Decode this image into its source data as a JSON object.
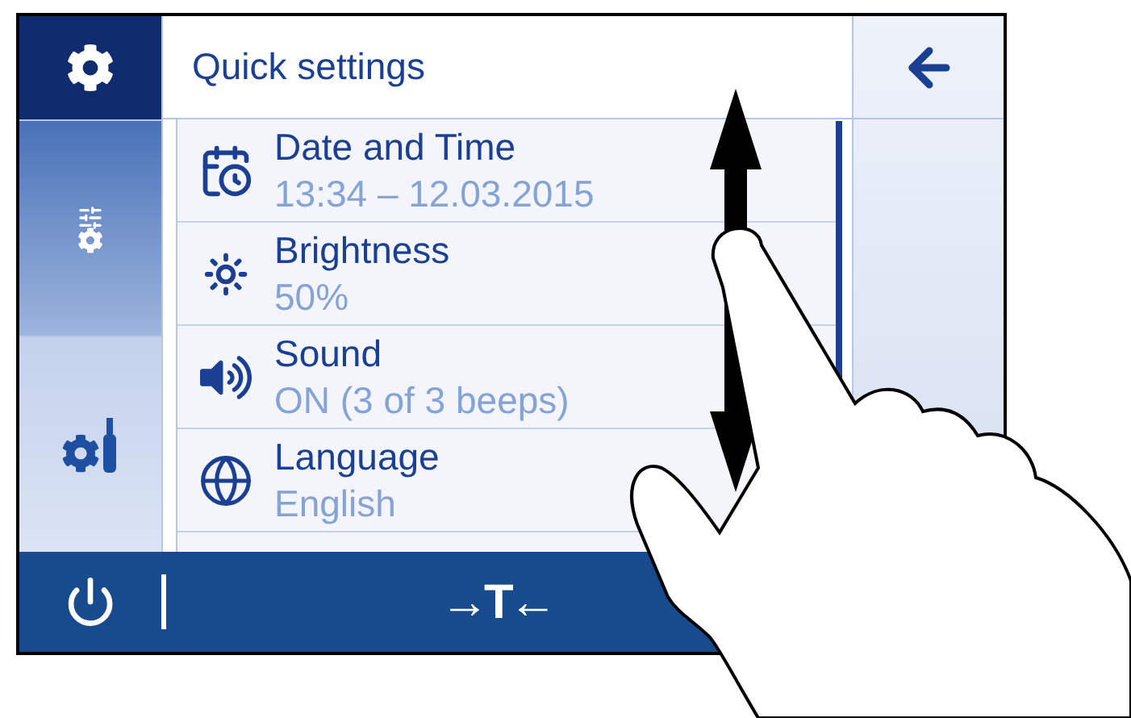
{
  "sidebar": {
    "items": [
      {
        "kind": "settings",
        "selected": true
      },
      {
        "kind": "configuration",
        "selected": false
      },
      {
        "kind": "maintenance",
        "selected": false
      }
    ]
  },
  "header": {
    "title": "Quick settings"
  },
  "settings_list": [
    {
      "kind": "datetime",
      "label": "Date and Time",
      "value": "13:34 – 12.03.2015"
    },
    {
      "kind": "brightness",
      "label": "Brightness",
      "value": "50%"
    },
    {
      "kind": "sound",
      "label": "Sound",
      "value": "ON (3 of 3 beeps)"
    },
    {
      "kind": "language",
      "label": "Language",
      "value": "English"
    }
  ],
  "bottom_bar": {
    "tare_label": "→T←"
  }
}
